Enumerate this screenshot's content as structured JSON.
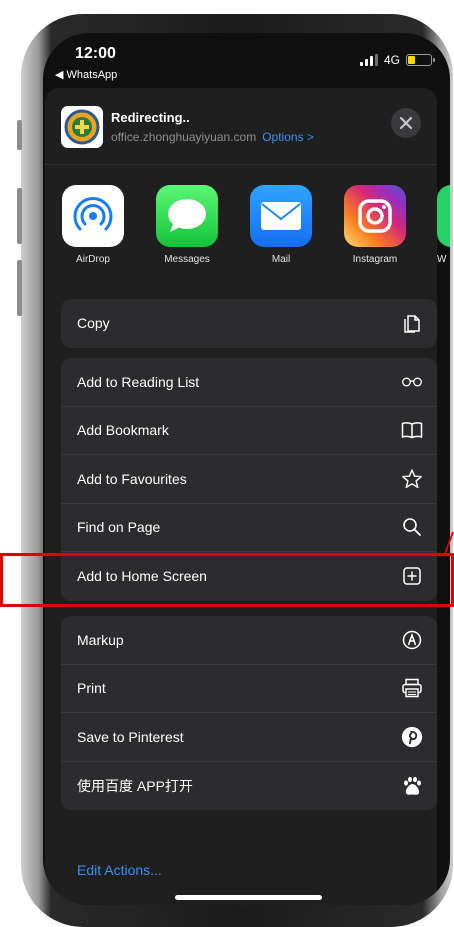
{
  "status_bar": {
    "time": "12:00",
    "back_app": "◀ WhatsApp",
    "network": "4G"
  },
  "share_sheet": {
    "site": {
      "title": "Redirecting..",
      "url": "office.zhonghuayiyuan.com",
      "options_label": "Options >"
    },
    "apps": [
      {
        "label": "AirDrop",
        "icon": "airdrop-icon"
      },
      {
        "label": "Messages",
        "icon": "messages-icon"
      },
      {
        "label": "Mail",
        "icon": "mail-icon"
      },
      {
        "label": "Instagram",
        "icon": "instagram-icon"
      },
      {
        "label": "W",
        "icon": "whatsapp-icon"
      }
    ],
    "group1": [
      {
        "label": "Copy",
        "icon": "copy-icon"
      }
    ],
    "group2": [
      {
        "label": "Add to Reading List",
        "icon": "glasses-icon"
      },
      {
        "label": "Add Bookmark",
        "icon": "book-icon"
      },
      {
        "label": "Add to Favourites",
        "icon": "star-icon"
      },
      {
        "label": "Find on Page",
        "icon": "search-icon"
      },
      {
        "label": "Add to Home Screen",
        "icon": "plus-square-icon"
      }
    ],
    "group3": [
      {
        "label": "Markup",
        "icon": "markup-icon"
      },
      {
        "label": "Print",
        "icon": "printer-icon"
      },
      {
        "label": "Save to Pinterest",
        "icon": "pinterest-icon"
      },
      {
        "label": "使用百度 APP打开",
        "icon": "baidu-icon"
      }
    ],
    "edit_actions": "Edit Actions..."
  },
  "colors": {
    "accent": "#3e8ef7",
    "highlight": "#e20000",
    "sheet_bg": "#1f1f1f",
    "row_bg": "#2c2c2e"
  }
}
